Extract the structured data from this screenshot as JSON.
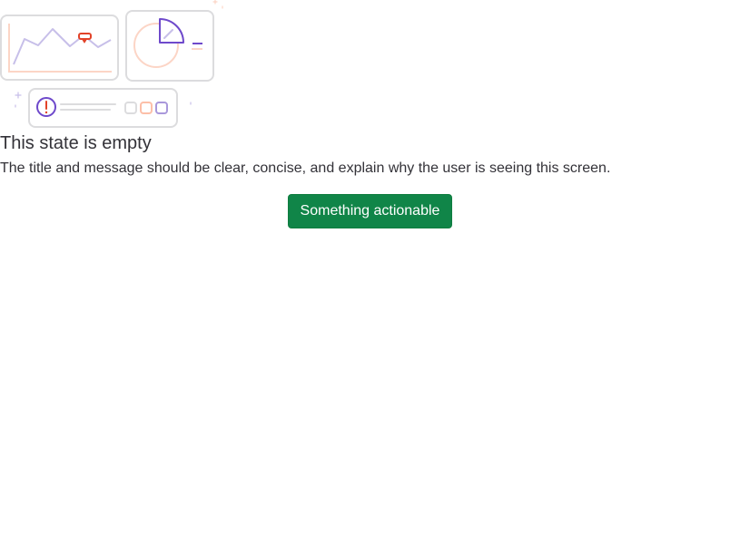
{
  "empty_state": {
    "title": "This state is empty",
    "message": "The title and message should be clear, concise, and explain why the user is seeing this screen.",
    "action_label": "Something actionable"
  },
  "icons": {
    "illustration": "empty-state-illustration",
    "line_chart": "line-chart-icon",
    "pie_chart": "pie-chart-icon",
    "alert": "alert-icon",
    "status_badge": "status-badge-icon"
  },
  "colors": {
    "primary_button": "#108548",
    "title_text": "#333238",
    "illustration_purple": "#6e49cb",
    "illustration_orange": "#e24329",
    "illustration_light_purple": "#c7bfe9",
    "illustration_light_orange": "#fcd5c6",
    "illustration_border": "#dcdcde"
  }
}
